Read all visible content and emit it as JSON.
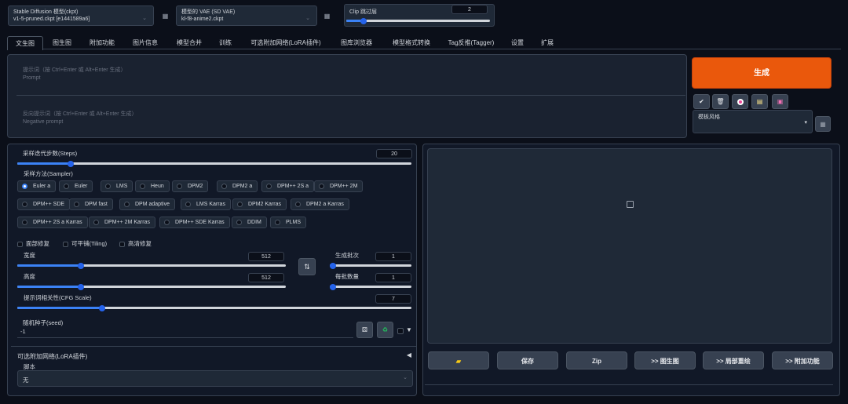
{
  "top": {
    "ckpt_label": "Stable Diffusion 模型(ckpt)",
    "ckpt_value": "v1-5-pruned.ckpt [e1441589a6]",
    "vae_label": "模型的 VAE (SD VAE)",
    "vae_value": "kl-f8-anime2.ckpt",
    "clip_label": "Clip 跳过层",
    "clip_value": "2",
    "clip_level": 0.1
  },
  "tabs": [
    "文生图",
    "图生图",
    "附加功能",
    "图片信息",
    "模型合并",
    "训练",
    "可选附加网络(LoRA插件)",
    "图库浏览器",
    "模型格式转换",
    "Tag反推(Tagger)",
    "设置",
    "扩展"
  ],
  "prompt": {
    "placeholder1": "提示词（按 Ctrl+Enter 或 Alt+Enter 生成）",
    "placeholder2": "Prompt",
    "neg_placeholder1": "反向提示词（按 Ctrl+Enter 或 Alt+Enter 生成）",
    "neg_placeholder2": "Negative prompt"
  },
  "generate": {
    "label": "生成",
    "style_label": "模板风格",
    "tool_icons": [
      "check-icon",
      "trash-icon",
      "lora-icon",
      "clipboard-icon",
      "save-icon"
    ],
    "colors": {
      "generate": "#ea580c"
    }
  },
  "steps": {
    "label": "采样迭代步数(Steps)",
    "value": "20",
    "level": 0.13
  },
  "sampler": {
    "label": "采样方法(Sampler)",
    "selected": "Euler a",
    "rows": [
      [
        "Euler a",
        "Euler",
        "LMS",
        "Heun",
        "DPM2",
        "DPM2 a",
        "DPM++ 2S a",
        "DPM++ 2M"
      ],
      [
        "DPM++ SDE",
        "DPM fast",
        "DPM adaptive",
        "LMS Karras",
        "DPM2 Karras",
        "DPM2 a Karras"
      ],
      [
        "DPM++ 2S a Karras",
        "DPM++ 2M Karras",
        "DPM++ SDE Karras",
        "DDIM",
        "PLMS"
      ]
    ]
  },
  "checks": {
    "face": "面部修复",
    "tiling": "可平铺(Tiling)",
    "hires": "高清修复"
  },
  "width": {
    "label": "宽度",
    "value": "512",
    "level": 0.23
  },
  "height": {
    "label": "高度",
    "value": "512",
    "level": 0.23
  },
  "batch_count": {
    "label": "生成批次",
    "value": "1",
    "level": 0.0
  },
  "batch_size": {
    "label": "每批数量",
    "value": "1",
    "level": 0.0
  },
  "swap_icon": "swap-icon",
  "cfg": {
    "label": "提示词相关性(CFG Scale)",
    "value": "7",
    "level": 0.21
  },
  "seed": {
    "label": "随机种子(seed)",
    "value": "-1"
  },
  "lora": {
    "label": "可选附加网络(LoRA插件)"
  },
  "script": {
    "label": "脚本",
    "value": "无"
  },
  "output": {
    "buttons": [
      "保存",
      "Zip",
      ">> 图生图",
      ">> 局部重绘",
      ">> 附加功能"
    ]
  }
}
